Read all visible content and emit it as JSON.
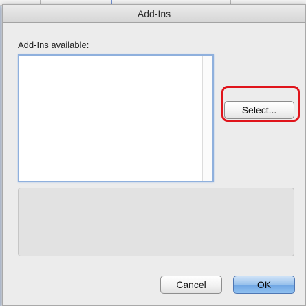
{
  "window": {
    "title": "Add-Ins"
  },
  "addins": {
    "label": "Add-Ins available:",
    "items": [],
    "select_label": "Select..."
  },
  "buttons": {
    "cancel_label": "Cancel",
    "ok_label": "OK"
  },
  "colors": {
    "highlight_ring": "#e0141b",
    "default_button": "#8fc0f0",
    "list_focus_border": "#8fb0dd"
  }
}
